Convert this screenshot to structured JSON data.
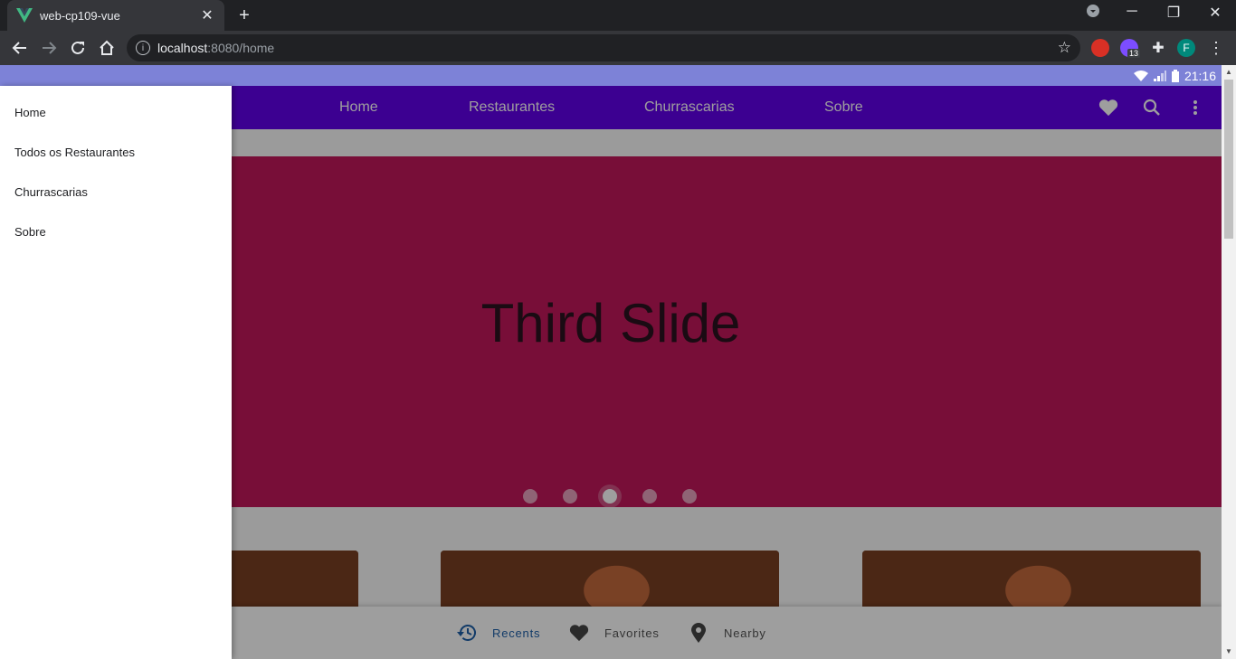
{
  "browser": {
    "tab_title": "web-cp109-vue",
    "tab_close": "✕",
    "new_tab": "+",
    "url_host": "localhost",
    "url_path": ":8080/home",
    "extension_badge": "13",
    "profile_initial": "F"
  },
  "status_bar": {
    "time": "21:16"
  },
  "app_bar": {
    "nav": [
      "Home",
      "Restaurantes",
      "Churrascarias",
      "Sobre"
    ]
  },
  "carousel": {
    "slide_text": "Third Slide",
    "dot_count": 5,
    "active_index": 2,
    "background": "#c2185b"
  },
  "bottom_nav": {
    "items": [
      {
        "label": "Recents",
        "icon": "history-icon",
        "active": true
      },
      {
        "label": "Favorites",
        "icon": "heart-icon",
        "active": false
      },
      {
        "label": "Nearby",
        "icon": "map-marker-icon",
        "active": false
      }
    ]
  },
  "drawer": {
    "items": [
      "Home",
      "Todos os Restaurantes",
      "Churrascarias",
      "Sobre"
    ]
  },
  "colors": {
    "app_bar": "#6200ea",
    "status_bar": "#7d82d7",
    "active_bottom": "#1e5fa8"
  }
}
